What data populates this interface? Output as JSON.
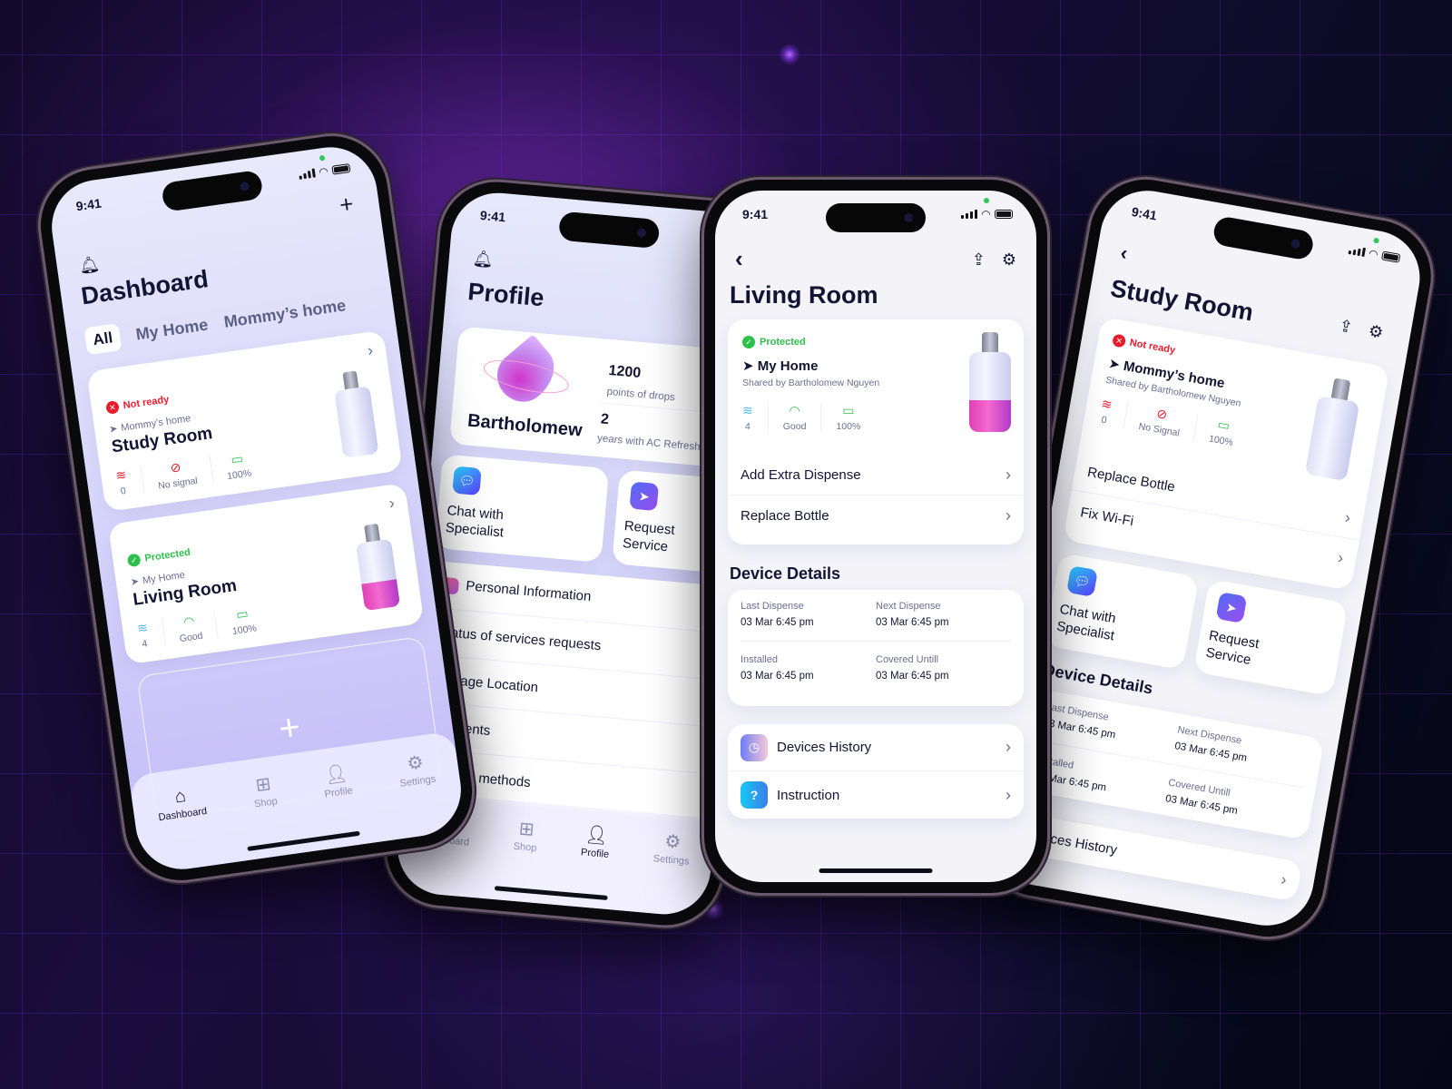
{
  "status_time": "9:41",
  "dashboard": {
    "title": "Dashboard",
    "tabs": [
      {
        "label": "All",
        "active": true
      },
      {
        "label": "My Home",
        "active": false
      },
      {
        "label": "Mommy’s home",
        "active": false
      }
    ],
    "devices": [
      {
        "status": "Not ready",
        "status_color": "#ea1c2c",
        "location": "Mommy’s home",
        "room": "Study Room",
        "metrics": [
          {
            "icon": "wind-icon",
            "value": "0"
          },
          {
            "icon": "wifi-off-icon",
            "value": "No signal"
          },
          {
            "icon": "battery-icon",
            "value": "100%"
          }
        ],
        "fill_level": 0
      },
      {
        "status": "Protected",
        "status_color": "#2fbf4b",
        "location": "My Home",
        "room": "Living Room",
        "metrics": [
          {
            "icon": "wind-icon",
            "value": "4"
          },
          {
            "icon": "wifi-icon",
            "value": "Good"
          },
          {
            "icon": "battery-icon",
            "value": "100%"
          }
        ],
        "fill_level": 0.4
      }
    ],
    "add_label": "+"
  },
  "profile": {
    "title": "Profile",
    "user_name": "Bartholomew",
    "points": "1200",
    "points_label": "points of drops",
    "years": "2",
    "years_label": "years with AC Refresh Pr",
    "quick_actions": [
      {
        "label": "Chat with Specialist",
        "icon": "chat-bubble-icon"
      },
      {
        "label": "Request Service",
        "icon": "send-plane-icon"
      }
    ],
    "menu": [
      "Personal Information",
      "Status of services requests",
      "Manage Location",
      "Payments",
      "Delivery methods"
    ]
  },
  "living_room": {
    "title": "Living Room",
    "status": "Protected",
    "home": "My Home",
    "shared_by": "Shared by Bartholomew Nguyen",
    "metrics": [
      {
        "icon": "wind-icon",
        "value": "4"
      },
      {
        "icon": "wifi-icon",
        "value": "Good"
      },
      {
        "icon": "battery-icon",
        "value": "100%"
      }
    ],
    "fill_level": 0.4,
    "actions": [
      "Add Extra Dispense",
      "Replace Bottle"
    ],
    "details_title": "Device Details",
    "details": [
      {
        "label": "Last Dispense",
        "value": "03 Mar 6:45 pm"
      },
      {
        "label": "Next Dispense",
        "value": "03 Mar 6:45 pm"
      },
      {
        "label": "Installed",
        "value": "03 Mar 6:45 pm"
      },
      {
        "label": "Covered Untill",
        "value": "03 Mar 6:45 pm"
      }
    ],
    "links": [
      {
        "label": "Devices History",
        "icon": "clock-icon"
      },
      {
        "label": "Instruction",
        "icon": "question-icon"
      }
    ]
  },
  "study_room": {
    "title": "Study Room",
    "status": "Not ready",
    "home": "Mommy’s home",
    "shared_by": "Shared by Bartholomew Nguyen",
    "metrics": [
      {
        "icon": "wind-icon",
        "value": "0"
      },
      {
        "icon": "wifi-off-icon",
        "value": "No Signal"
      },
      {
        "icon": "battery-icon",
        "value": "100%"
      }
    ],
    "fill_level": 0,
    "actions": [
      "Replace Bottle",
      "Fix Wi-Fi"
    ],
    "quick_actions": [
      {
        "label": "Chat with Specialist"
      },
      {
        "label": "Request Service"
      }
    ],
    "details_title": "Device Details",
    "details": [
      {
        "label": "Last Dispense",
        "value": "03 Mar 6:45 pm"
      },
      {
        "label": "Next Dispense",
        "value": "03 Mar 6:45 pm"
      },
      {
        "label": "Installed",
        "value": "03 Mar 6:45 pm"
      },
      {
        "label": "Covered Untill",
        "value": "03 Mar 6:45 pm"
      }
    ],
    "links": [
      {
        "label": "Devices History"
      }
    ]
  },
  "nav": [
    {
      "label": "Dashboard",
      "icon": "home-icon"
    },
    {
      "label": "Shop",
      "icon": "grid-icon"
    },
    {
      "label": "Profile",
      "icon": "user-icon"
    },
    {
      "label": "Settings",
      "icon": "gear-icon"
    }
  ],
  "colors": {
    "accent": "#7b5cff",
    "protected": "#2fbf4b",
    "not_ready": "#ea1c2c",
    "text": "#121433",
    "muted": "#6a6f95"
  }
}
